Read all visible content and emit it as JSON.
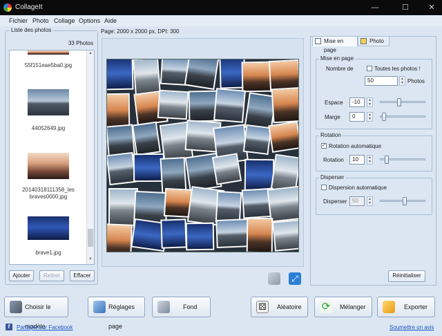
{
  "window": {
    "title": "CollageIt"
  },
  "menu": [
    "Fichier",
    "Photo",
    "Collage",
    "Options",
    "Aide"
  ],
  "photo_list": {
    "title": "Liste des photos",
    "count": "33 Photos",
    "items": [
      {
        "filename": "55f151eae5ba0.jpg"
      },
      {
        "filename": "44052649.jpg"
      },
      {
        "filename": "20140318111358_les braves0000.jpg"
      },
      {
        "filename": "brave1.jpg"
      }
    ],
    "buttons": {
      "add": "Ajouter",
      "remove": "Retirer",
      "clear": "Effacer"
    }
  },
  "page_info": "Page: 2000 x 2000 px, DPI: 300",
  "tabs": {
    "layout": "Mise en page",
    "photo": "Photo"
  },
  "layout_group": {
    "title": "Mise en page",
    "count_label": "Nombre de",
    "all_photos_label": "Toutes les photos !",
    "all_photos_checked": false,
    "count_value": "50",
    "count_unit": "Photos",
    "spacing_label": "Espace",
    "spacing_value": "-10",
    "margin_label": "Marge",
    "margin_value": "0"
  },
  "rotation_group": {
    "title": "Rotation",
    "auto_label": "Rotation automatique",
    "auto_checked": true,
    "rotation_label": "Rotation",
    "rotation_value": "10"
  },
  "scatter_group": {
    "title": "Disperser",
    "auto_label": "Dispersion automatique",
    "auto_checked": false,
    "scatter_label": "Disperser",
    "scatter_value": "50"
  },
  "reset_button": "Réinitialiser",
  "bottom_buttons": {
    "choose_model": "Choisir le modèle",
    "page_settings": "Réglages page",
    "background": "Fond",
    "random": "Aléatoire",
    "shuffle": "Mélanger",
    "export": "Exporter"
  },
  "links": {
    "facebook": "Partager sur Facebook",
    "review": "Soumettre un avis"
  },
  "colors": {
    "titlebar": "#0b0b0b",
    "background": "#dbe6f2",
    "link": "#1b55c7",
    "facebook": "#3b5998"
  },
  "icons": {
    "app": "collageit-logo-icon",
    "crop": "crop-icon",
    "fit": "fit-screen-icon",
    "choose_model": "template-icon",
    "page_settings": "page-settings-icon",
    "background": "background-image-icon",
    "random": "dice-icon",
    "shuffle": "shuffle-arrows-icon",
    "export": "export-folder-icon",
    "facebook": "facebook-icon"
  }
}
